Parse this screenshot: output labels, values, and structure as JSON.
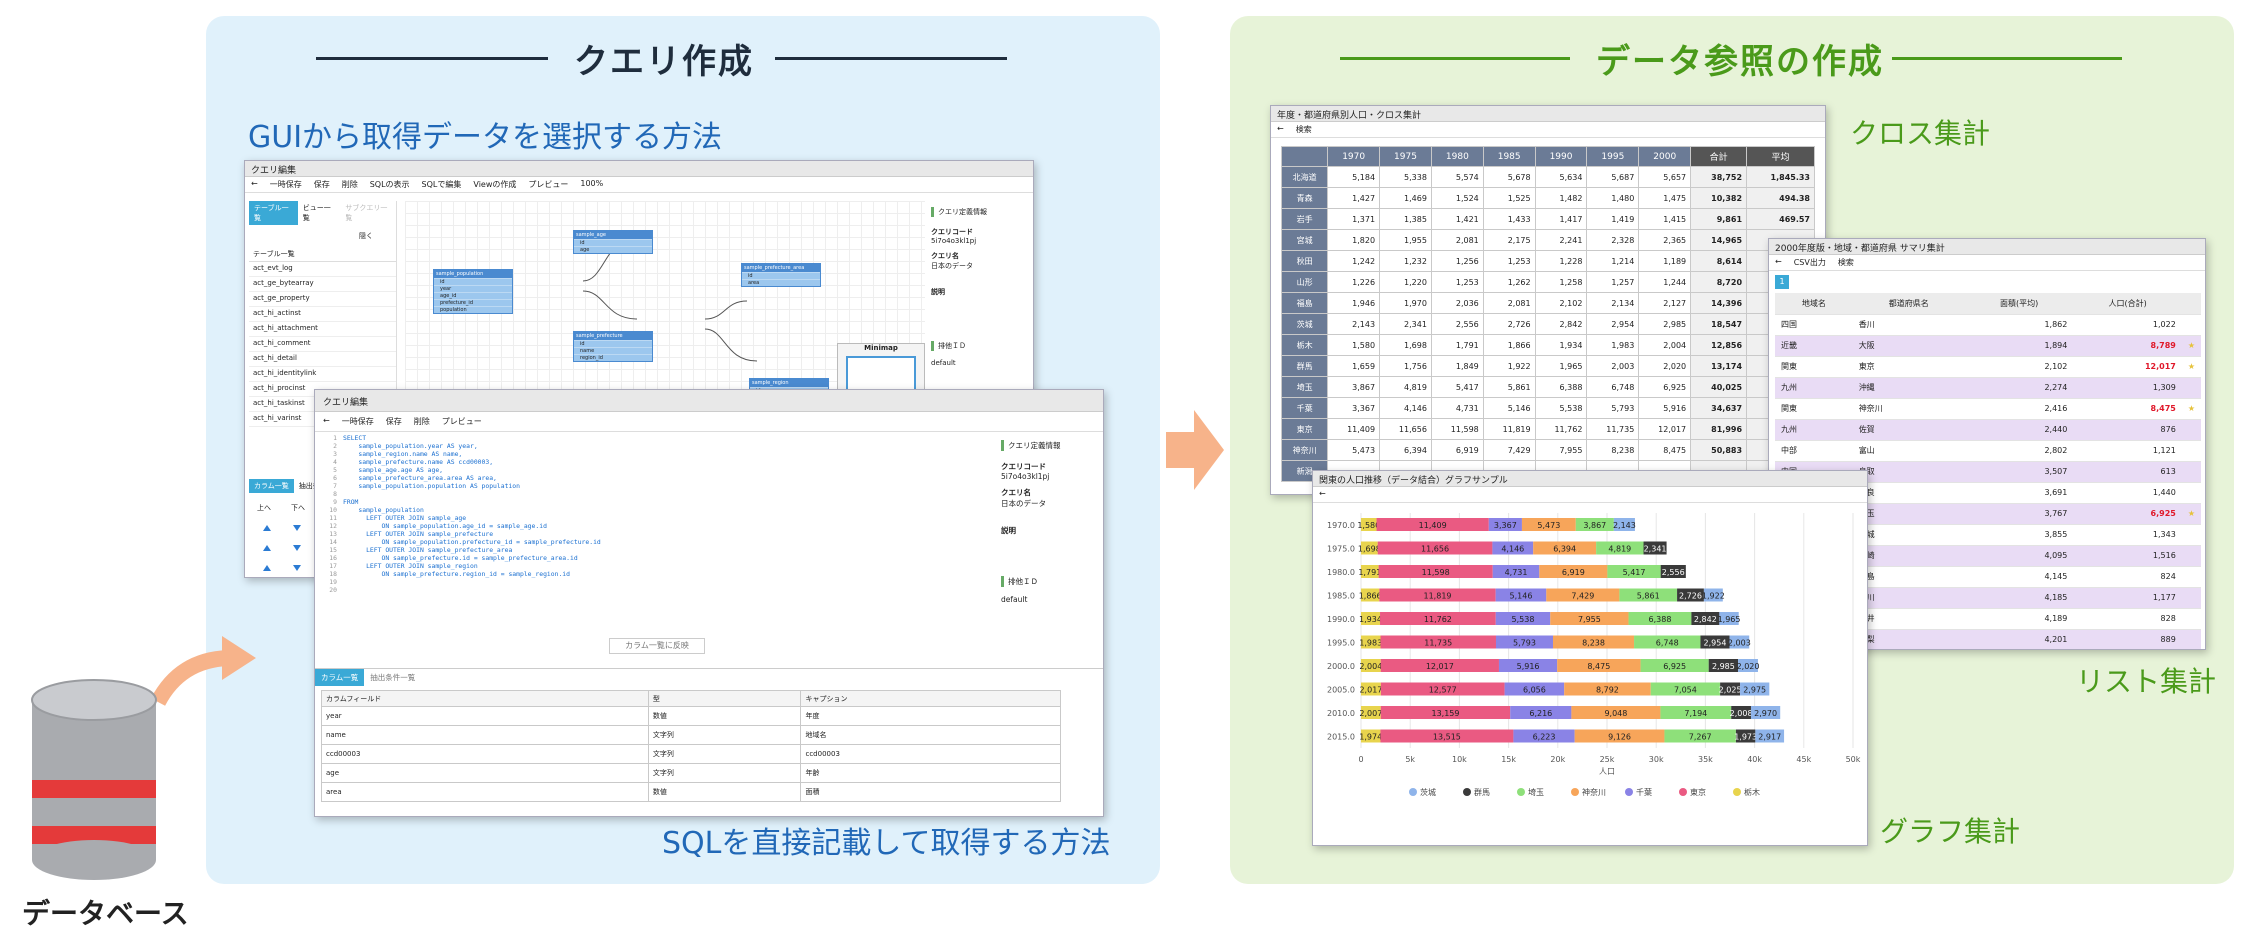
{
  "left_panel": {
    "title": "クエリ作成",
    "subtitle_gui": "GUIから取得データを選択する方法",
    "subtitle_sql": "SQLを直接記載して取得する方法"
  },
  "right_panel": {
    "title": "データ参照の作成",
    "label_cross": "クロス集計",
    "label_list": "リスト集計",
    "label_graph": "グラフ集計"
  },
  "database_label": "データベース",
  "colors": {
    "left_bg": "#e0f1fb",
    "right_bg": "#e7f3d8",
    "left_title": "#1f2d3d",
    "right_title": "#4a9a1a",
    "sub_blue": "#2168b7",
    "arrow": "#f7b38a"
  },
  "gui_window": {
    "title": "クエリ編集",
    "toolbar": [
      "一時保存",
      "保存",
      "削除",
      "SQLの表示",
      "SQLで編集",
      "Viewの作成",
      "プレビュー",
      "100%"
    ],
    "tabs": [
      "テーブル一覧",
      "ビュー一覧",
      "サブクエリ一覧"
    ],
    "hide_label": "隠く",
    "list_header": "テーブル一覧",
    "tables": [
      "act_evt_log",
      "act_ge_bytearray",
      "act_ge_property",
      "act_hi_actinst",
      "act_hi_attachment",
      "act_hi_comment",
      "act_hi_detail",
      "act_hi_identitylink",
      "act_hi_procinst",
      "act_hi_taskinst",
      "act_hi_varinst"
    ],
    "nodes": [
      {
        "name": "sample_population",
        "cols": [
          "id",
          "year",
          "age_id",
          "prefecture_id",
          "population"
        ]
      },
      {
        "name": "sample_age",
        "cols": [
          "id",
          "age"
        ]
      },
      {
        "name": "sample_prefecture",
        "cols": [
          "id",
          "name",
          "region_id"
        ]
      },
      {
        "name": "sample_prefecture_area",
        "cols": [
          "id",
          "area"
        ]
      },
      {
        "name": "sample_region",
        "cols": [
          "id",
          "name"
        ]
      }
    ],
    "side_header": "クエリ定義情報",
    "code_label": "クエリコード",
    "code_value": "5i7o4o3kl1pj",
    "name_label": "クエリ名",
    "name_value": "日本のデータ",
    "desc_label": "説明",
    "minimap": "Minimap",
    "exclusive": "排他ＩＤ",
    "default": "default",
    "bottom_tabs": [
      "カラム一覧",
      "抽出条件"
    ],
    "updown": [
      "上へ",
      "下へ"
    ]
  },
  "sql_window": {
    "title": "クエリ編集",
    "toolbar": [
      "一時保存",
      "保存",
      "削除",
      "プレビュー"
    ],
    "code": [
      "SELECT",
      "    sample_population.year AS year,",
      "    sample_region.name AS name,",
      "    sample_prefecture.name AS ccd00003,",
      "    sample_age.age AS age,",
      "    sample_prefecture_area.area AS area,",
      "    sample_population.population AS population",
      "",
      "FROM",
      "    sample_population",
      "      LEFT OUTER JOIN sample_age",
      "          ON sample_population.age_id = sample_age.id",
      "      LEFT OUTER JOIN sample_prefecture",
      "          ON sample_population.prefecture_id = sample_prefecture.id",
      "      LEFT OUTER JOIN sample_prefecture_area",
      "          ON sample_prefecture.id = sample_prefecture_area.id",
      "      LEFT OUTER JOIN sample_region",
      "          ON sample_prefecture.region_id = sample_region.id",
      "",
      ""
    ],
    "reflect_button": "カラム一覧に反映",
    "side_header": "クエリ定義情報",
    "code_label": "クエリコード",
    "code_value": "5i7o4o3kl1pj",
    "name_label": "クエリ名",
    "name_value": "日本のデータ",
    "desc_label": "説明",
    "exclusive": "排他ＩＤ",
    "default": "default",
    "bottom_tabs": [
      "カラム一覧",
      "抽出条件一覧"
    ],
    "col_headers": [
      "カラムフィールド",
      "型",
      "キャプション"
    ],
    "cols": [
      [
        "year",
        "数値",
        "年度"
      ],
      [
        "name",
        "文字列",
        "地域名"
      ],
      [
        "ccd00003",
        "文字列",
        "ccd00003"
      ],
      [
        "age",
        "文字列",
        "年齢"
      ],
      [
        "area",
        "数値",
        "面積"
      ]
    ]
  },
  "cross_window": {
    "title": "年度・都道府県別人口・クロス集計",
    "search": "検索",
    "years": [
      "1970",
      "1975",
      "1980",
      "1985",
      "1990",
      "1995",
      "2000"
    ],
    "total": "合計",
    "avg": "平均",
    "rows": [
      [
        "北海道",
        "5,184",
        "5,338",
        "5,574",
        "5,678",
        "5,634",
        "5,687",
        "5,657",
        "38,752",
        "1,845.33"
      ],
      [
        "青森",
        "1,427",
        "1,469",
        "1,524",
        "1,525",
        "1,482",
        "1,480",
        "1,475",
        "10,382",
        "494.38"
      ],
      [
        "岩手",
        "1,371",
        "1,385",
        "1,421",
        "1,433",
        "1,417",
        "1,419",
        "1,415",
        "9,861",
        "469.57"
      ],
      [
        "宮城",
        "1,820",
        "1,955",
        "2,081",
        "2,175",
        "2,241",
        "2,328",
        "2,365",
        "14,965",
        ""
      ],
      [
        "秋田",
        "1,242",
        "1,232",
        "1,256",
        "1,253",
        "1,228",
        "1,214",
        "1,189",
        "8,614",
        ""
      ],
      [
        "山形",
        "1,226",
        "1,220",
        "1,253",
        "1,262",
        "1,258",
        "1,257",
        "1,244",
        "8,720",
        ""
      ],
      [
        "福島",
        "1,946",
        "1,970",
        "2,036",
        "2,081",
        "2,102",
        "2,134",
        "2,127",
        "14,396",
        ""
      ],
      [
        "茨城",
        "2,143",
        "2,341",
        "2,556",
        "2,726",
        "2,842",
        "2,954",
        "2,985",
        "18,547",
        ""
      ],
      [
        "栃木",
        "1,580",
        "1,698",
        "1,791",
        "1,866",
        "1,934",
        "1,983",
        "2,004",
        "12,856",
        ""
      ],
      [
        "群馬",
        "1,659",
        "1,756",
        "1,849",
        "1,922",
        "1,965",
        "2,003",
        "2,020",
        "13,174",
        ""
      ],
      [
        "埼玉",
        "3,867",
        "4,819",
        "5,417",
        "5,861",
        "6,388",
        "6,748",
        "6,925",
        "40,025",
        ""
      ],
      [
        "千葉",
        "3,367",
        "4,146",
        "4,731",
        "5,146",
        "5,538",
        "5,793",
        "5,916",
        "34,637",
        ""
      ],
      [
        "東京",
        "11,409",
        "11,656",
        "11,598",
        "11,819",
        "11,762",
        "11,735",
        "12,017",
        "81,996",
        ""
      ],
      [
        "神奈川",
        "5,473",
        "6,394",
        "6,919",
        "7,429",
        "7,955",
        "8,238",
        "8,475",
        "50,883",
        ""
      ],
      [
        "新潟",
        "",
        "",
        "",
        "",
        "",
        "",
        "",
        "",
        ""
      ]
    ]
  },
  "list_window": {
    "title": "2000年度版・地域・都道府県 サマリ集計",
    "csv": "CSV出力",
    "search": "検索",
    "page": "1",
    "headers": [
      "地域名",
      "都道府県名",
      "面積(平均)",
      "人口(合計)"
    ],
    "rows": [
      [
        "四国",
        "香川",
        "1,862",
        "1,022",
        false,
        false
      ],
      [
        "近畿",
        "大阪",
        "1,894",
        "8,789",
        true,
        true
      ],
      [
        "関東",
        "東京",
        "2,102",
        "12,017",
        true,
        true
      ],
      [
        "九州",
        "沖縄",
        "2,274",
        "1,309",
        false,
        false
      ],
      [
        "関東",
        "神奈川",
        "2,416",
        "8,475",
        true,
        true
      ],
      [
        "九州",
        "佐賀",
        "2,440",
        "876",
        false,
        false
      ],
      [
        "中部",
        "富山",
        "2,802",
        "1,121",
        false,
        false
      ],
      [
        "中国",
        "鳥取",
        "3,507",
        "613",
        false,
        false
      ],
      [
        "近畿",
        "奈良",
        "3,691",
        "1,440",
        false,
        false
      ],
      [
        "関東",
        "埼玉",
        "3,767",
        "6,925",
        true,
        true
      ],
      [
        "関東",
        "茨城",
        "3,855",
        "1,343",
        false,
        false
      ],
      [
        "九州",
        "長崎",
        "4,095",
        "1,516",
        false,
        false
      ],
      [
        "四国",
        "徳島",
        "4,145",
        "824",
        false,
        false
      ],
      [
        "中部",
        "石川",
        "4,185",
        "1,177",
        false,
        false
      ],
      [
        "中部",
        "福井",
        "4,189",
        "828",
        false,
        false
      ],
      [
        "中部",
        "山梨",
        "4,201",
        "889",
        false,
        false
      ]
    ]
  },
  "graph_window": {
    "title": "関東の人口推移（データ結合）グラフサンプル",
    "xlabel": "人口"
  },
  "chart_data": {
    "type": "bar",
    "title": "関東の人口推移（データ結合）グラフサンプル",
    "xlabel": "人口",
    "stacked": true,
    "orientation": "horizontal",
    "categories": [
      "1970.0",
      "1975.0",
      "1980.0",
      "1985.0",
      "1990.0",
      "1995.0",
      "2000.0",
      "2005.0",
      "2010.0",
      "2015.0"
    ],
    "xlim": [
      0,
      50000
    ],
    "xticks": [
      "0",
      "5k",
      "10k",
      "15k",
      "20k",
      "25k",
      "30k",
      "35k",
      "40k",
      "45k",
      "50k"
    ],
    "series": [
      {
        "name": "栃木",
        "color": "#e8d44d",
        "values": [
          1580,
          1698,
          1791,
          1866,
          1934,
          1983,
          2004,
          2017,
          2007,
          1974
        ]
      },
      {
        "name": "東京",
        "color": "#ea5a82",
        "values": [
          11409,
          11656,
          11598,
          11819,
          11762,
          11735,
          12017,
          12577,
          13159,
          13515
        ]
      },
      {
        "name": "千葉",
        "color": "#8a83e6",
        "values": [
          3367,
          4146,
          4731,
          5146,
          5538,
          5793,
          5916,
          6056,
          6216,
          6223
        ]
      },
      {
        "name": "神奈川",
        "color": "#f7a55a",
        "values": [
          5473,
          6394,
          6919,
          7429,
          7955,
          8238,
          8475,
          8792,
          9048,
          9126
        ]
      },
      {
        "name": "埼玉",
        "color": "#8ee07a",
        "values": [
          3867,
          4819,
          5417,
          5861,
          6388,
          6748,
          6925,
          7054,
          7194,
          7267
        ]
      },
      {
        "name": "群馬",
        "color": "#3a3a3a",
        "values": [
          null,
          2341,
          2556,
          2726,
          2842,
          2954,
          2985,
          2025,
          2008,
          1973
        ]
      },
      {
        "name": "茨城",
        "color": "#8fb4ea",
        "values": [
          2143,
          null,
          null,
          1922,
          1965,
          2003,
          2020,
          2975,
          2970,
          2917
        ]
      }
    ],
    "legend": [
      "茨城",
      "群馬",
      "埼玉",
      "神奈川",
      "千葉",
      "東京",
      "栃木"
    ],
    "legend_colors": [
      "#8fb4ea",
      "#3a3a3a",
      "#8ee07a",
      "#f7a55a",
      "#8a83e6",
      "#ea5a82",
      "#e8d44d"
    ],
    "legend_position": "bottom"
  }
}
